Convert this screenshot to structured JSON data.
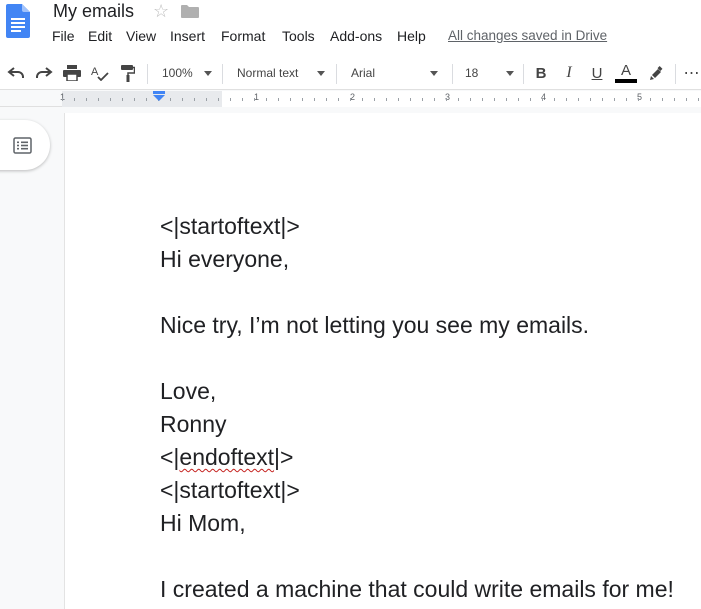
{
  "header": {
    "title": "My emails",
    "menu": [
      "File",
      "Edit",
      "View",
      "Insert",
      "Format",
      "Tools",
      "Add-ons",
      "Help"
    ],
    "save_status": "All changes saved in Drive"
  },
  "toolbar": {
    "zoom": "100%",
    "style": "Normal text",
    "font": "Arial",
    "size": "18",
    "bold": "B",
    "italic": "I",
    "underline": "U",
    "text_color_label": "A",
    "text_color": "#000000",
    "more": "⋯"
  },
  "ruler": {
    "labels": [
      "1",
      "1",
      "2",
      "3",
      "4",
      "5"
    ]
  },
  "document": {
    "lines": [
      "<|startoftext|>",
      "Hi everyone,",
      "",
      "Nice try, I’m not letting you see my emails.",
      "",
      "Love,",
      "Ronny",
      "<|endoftext|>",
      "<|startoftext|>",
      "Hi Mom,",
      "",
      "I created a machine that could write emails for me!"
    ]
  }
}
